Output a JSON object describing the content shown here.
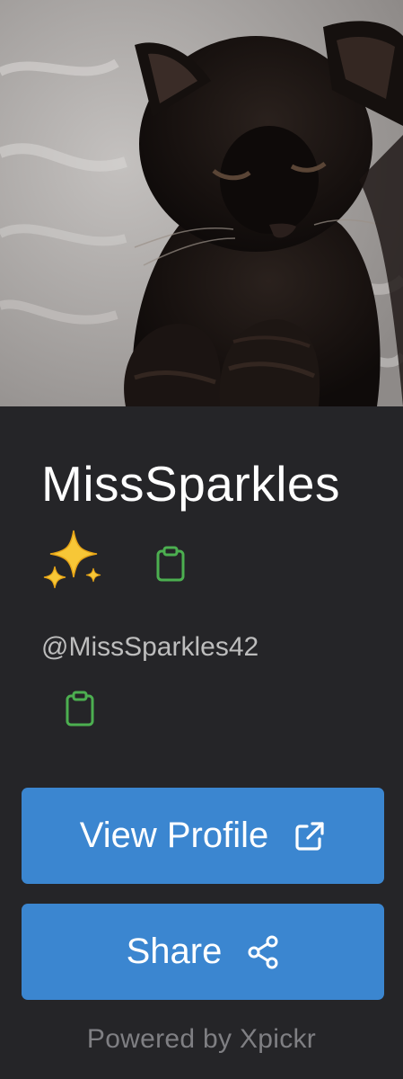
{
  "profile": {
    "display_name": "MissSparkles",
    "emoji": "sparkles",
    "handle": "@MissSparkles42",
    "photo": "black-cat-on-blanket"
  },
  "actions": {
    "view_profile_label": "View Profile",
    "share_label": "Share"
  },
  "footer": {
    "powered_by": "Powered by Xpickr"
  },
  "icons": {
    "copy_name": "clipboard-icon",
    "copy_handle": "clipboard-icon",
    "view_profile": "external-link-icon",
    "share": "share-icon"
  },
  "colors": {
    "background": "#252528",
    "button": "#3b86d0",
    "clipboard": "#4caf50",
    "handle_text": "#bdbdbd",
    "footer_text": "#7f7f83"
  }
}
